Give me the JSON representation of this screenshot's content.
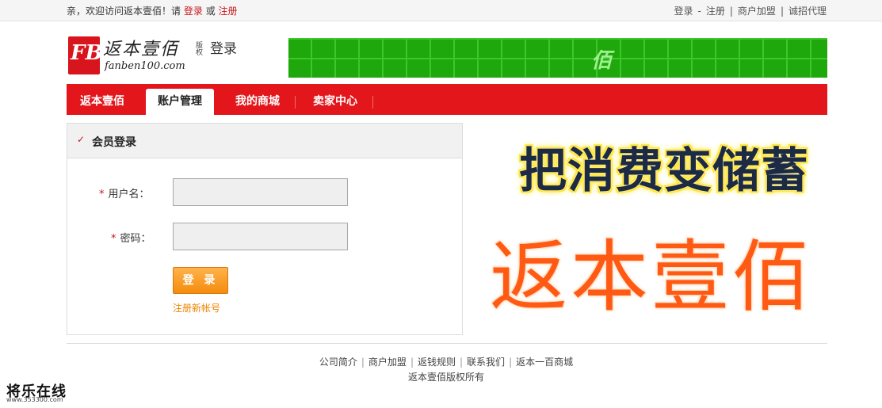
{
  "topbar": {
    "welcome": "亲，欢迎访问返本壹佰！请",
    "login_link": "登录",
    "or": "或",
    "register_link": "注册",
    "right_links": [
      "登录",
      "注册",
      "商户加盟",
      "诚招代理"
    ],
    "right_seps": [
      "-",
      "|",
      "|"
    ]
  },
  "header": {
    "logo_letters": "FB",
    "logo_cn": "返本壹佰",
    "logo_en": "fanben100.com",
    "logo_tag": "版权",
    "page_title": "登录",
    "banner_glyph": "佰"
  },
  "nav": {
    "items": [
      "返本壹佰",
      "账户管理",
      "我的商城",
      "卖家中心"
    ],
    "active_index": 1
  },
  "login": {
    "title": "会员登录",
    "username_label": "用户名：",
    "password_label": "密码：",
    "username_value": "",
    "password_value": "",
    "submit": "登 录",
    "register_new": "注册新帐号"
  },
  "promo": {
    "slogan": "把消费变储蓄",
    "brand": "返本壹佰"
  },
  "footer": {
    "links": [
      "公司简介",
      "商户加盟",
      "返钱规则",
      "联系我们",
      "返本一百商城"
    ],
    "copyright": "返本壹佰版权所有"
  },
  "watermark": {
    "title": "将乐在线",
    "url": "www.353300.com"
  },
  "colors": {
    "brand_red": "#e3161c",
    "banner_green": "#1fa80c",
    "button_orange": "#f48c0e"
  }
}
